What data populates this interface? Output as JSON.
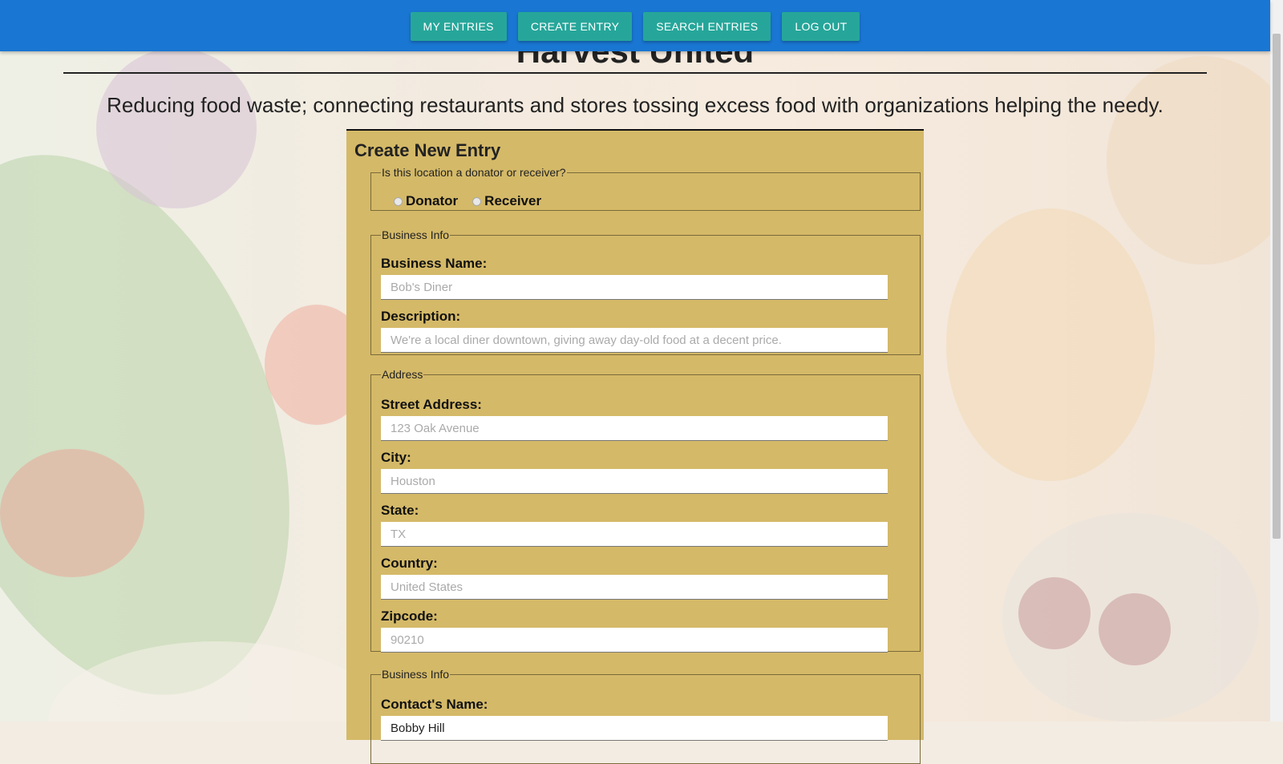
{
  "nav": {
    "my_entries": "MY ENTRIES",
    "create_entry": "CREATE ENTRY",
    "search_entries": "SEARCH ENTRIES",
    "log_out": "LOG OUT"
  },
  "site": {
    "title": "Harvest United",
    "tagline": "Reducing food waste; connecting restaurants and stores tossing excess food with organizations helping the needy."
  },
  "form": {
    "title": "Create New Entry",
    "type_section": {
      "legend": "Is this location a donator or receiver?",
      "options": [
        "Donator",
        "Receiver"
      ]
    },
    "business_section": {
      "legend": "Business Info",
      "name_label": "Business Name:",
      "name_placeholder": "Bob's Diner",
      "description_label": "Description:",
      "description_placeholder": "We're a local diner downtown, giving away day-old food at a decent price."
    },
    "address_section": {
      "legend": "Address",
      "street_label": "Street Address:",
      "street_placeholder": "123 Oak Avenue",
      "city_label": "City:",
      "city_placeholder": "Houston",
      "state_label": "State:",
      "state_placeholder": "TX",
      "country_label": "Country:",
      "country_placeholder": "United States",
      "zip_label": "Zipcode:",
      "zip_placeholder": "90210"
    },
    "contact_section": {
      "legend": "Business Info",
      "contact_label": "Contact's Name:",
      "contact_value": "Bobby Hill"
    }
  },
  "colors": {
    "navbar": "#1976d2",
    "nav_button": "#26a69a",
    "form_background": "#d4b968"
  }
}
